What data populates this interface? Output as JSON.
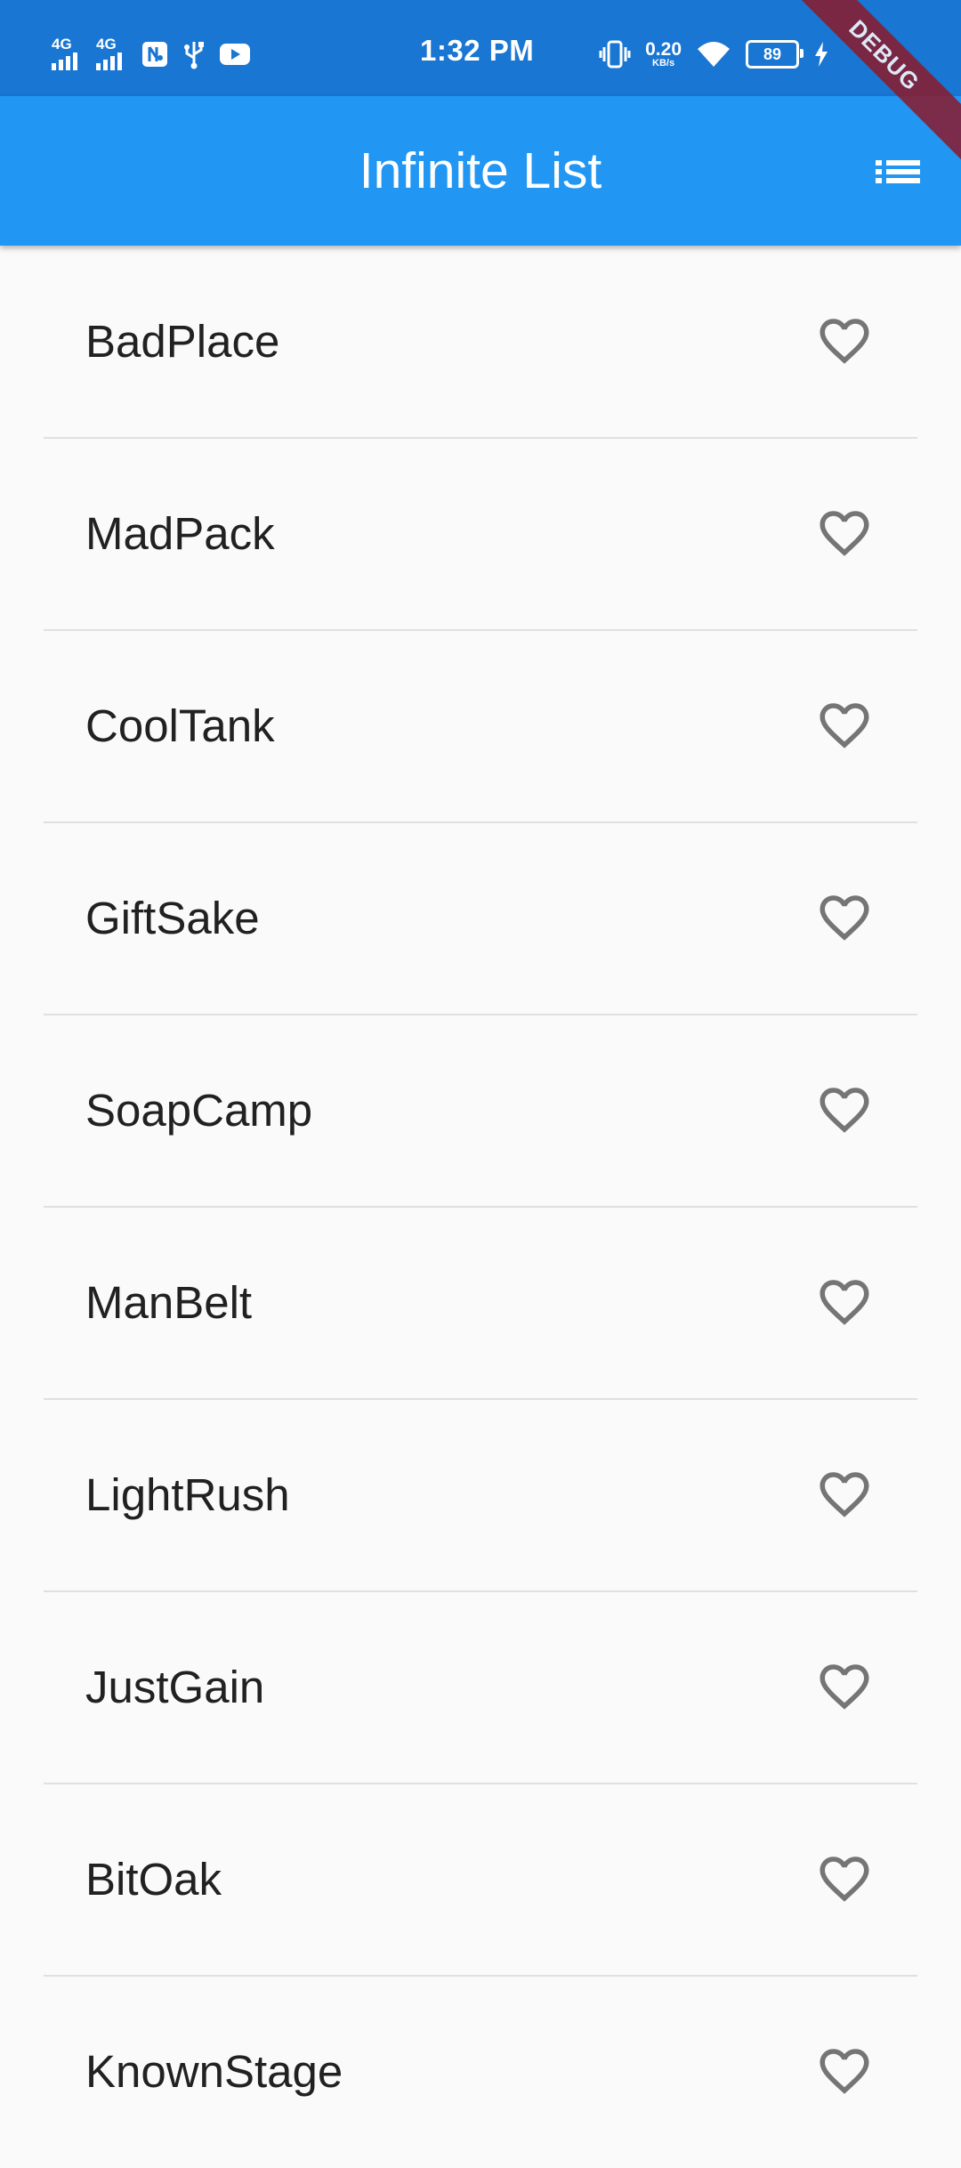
{
  "status_bar": {
    "time": "1:32 PM",
    "net_speed_value": "0.20",
    "net_speed_unit": "KB/s",
    "battery": "89",
    "sim1": "4G",
    "sim2": "4G",
    "icons": [
      "sim-4g-icon",
      "sim-4g-icon",
      "nfc-icon",
      "usb-icon",
      "youtube-icon",
      "vibrate-icon",
      "wifi-icon",
      "battery-icon",
      "charging-icon"
    ]
  },
  "debug_banner": "DEBUG",
  "app_bar": {
    "title": "Infinite List",
    "action_icon": "list-icon",
    "color": "#2196f3"
  },
  "list": {
    "items": [
      {
        "name": "BadPlace",
        "favorite": false
      },
      {
        "name": "MadPack",
        "favorite": false
      },
      {
        "name": "CoolTank",
        "favorite": false
      },
      {
        "name": "GiftSake",
        "favorite": false
      },
      {
        "name": "SoapCamp",
        "favorite": false
      },
      {
        "name": "ManBelt",
        "favorite": false
      },
      {
        "name": "LightRush",
        "favorite": false
      },
      {
        "name": "JustGain",
        "favorite": false
      },
      {
        "name": "BitOak",
        "favorite": false
      },
      {
        "name": "KnownStage",
        "favorite": false
      }
    ],
    "favorite_icon": "heart-outline-icon",
    "icon_color": "#757575"
  }
}
